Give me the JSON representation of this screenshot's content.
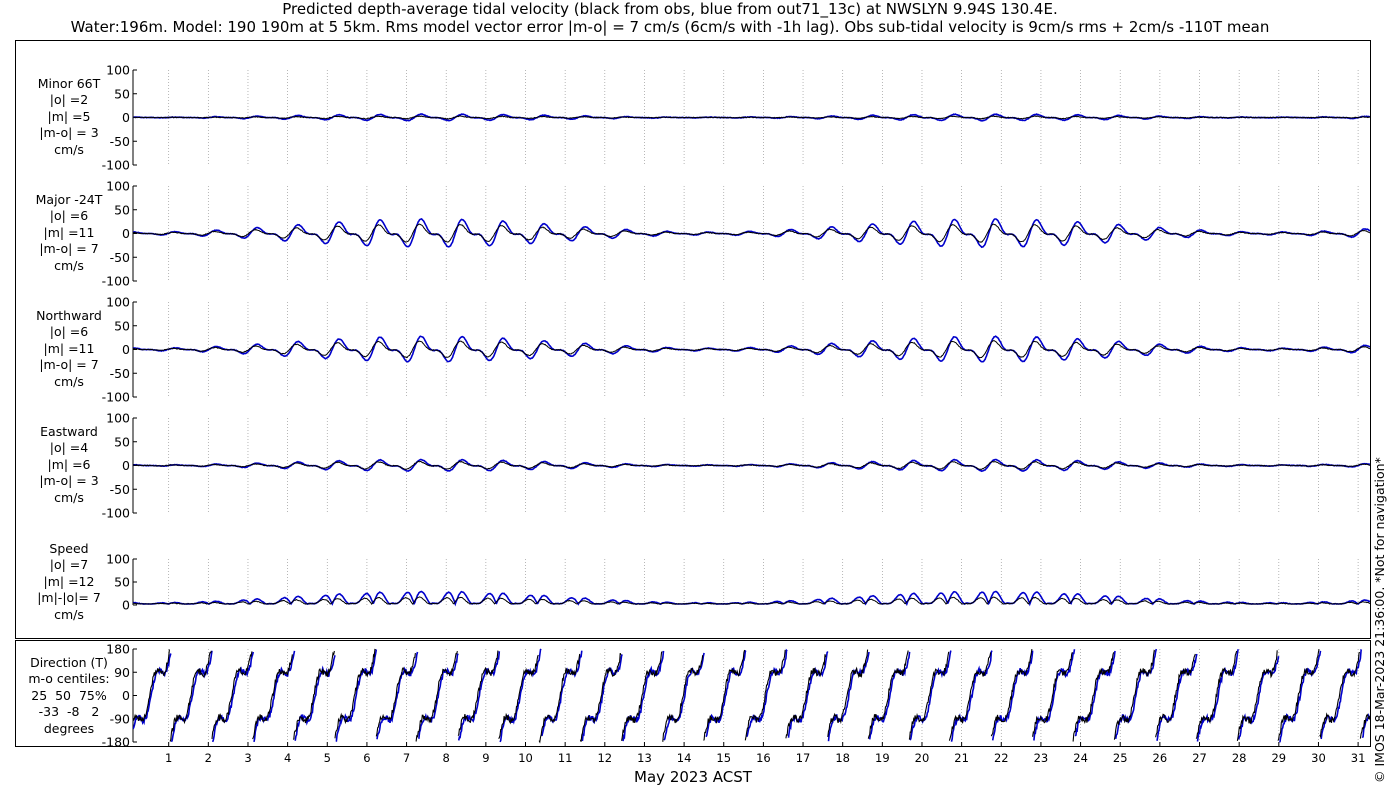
{
  "title_line1": "Predicted depth-average tidal velocity (black from obs, blue from out71_13c) at NWSLYN 9.94S 130.4E.",
  "title_line2": "Water:196m. Model: 190 190m at 5 5km. Rms model vector error |m-o| = 7 cm/s (6cm/s with -1h lag). Obs sub-tidal velocity is 9cm/s rms + 2cm/s -110T mean",
  "copyright": "© IMOS 18-Mar-2023 21:36:00. *Not for navigation*",
  "colors": {
    "obs": "#000000",
    "model": "#0000cc",
    "grid": "#999999"
  },
  "chart_data": {
    "type": "line",
    "xlabel": "May 2023 ACST",
    "xlim": [
      0.1,
      31.3
    ],
    "x_ticks": [
      1,
      2,
      3,
      4,
      5,
      6,
      7,
      8,
      9,
      10,
      11,
      12,
      13,
      14,
      15,
      16,
      17,
      18,
      19,
      20,
      21,
      22,
      23,
      24,
      25,
      26,
      27,
      28,
      29,
      30,
      31
    ],
    "series_legend": {
      "obs": "black from obs",
      "model": "blue from out71_13c"
    },
    "panels": [
      {
        "id": "minor",
        "label": [
          "Minor 66T",
          "|o| =2",
          "|m| =5",
          "|m-o| = 3",
          "cm/s"
        ],
        "ylim": [
          -100,
          100
        ],
        "yticks": [
          100,
          50,
          0,
          -50,
          -100
        ],
        "model_amp": 5,
        "obs_amp": 2,
        "signed": true
      },
      {
        "id": "major",
        "label": [
          "Major -24T",
          "|o| =6",
          "|m| =11",
          "|m-o| = 7",
          "cm/s"
        ],
        "ylim": [
          -100,
          100
        ],
        "yticks": [
          100,
          50,
          0,
          -50,
          -100
        ],
        "model_amp": 22,
        "obs_amp": 14,
        "signed": true
      },
      {
        "id": "north",
        "label": [
          "Northward",
          "|o| =6",
          "|m| =11",
          "|m-o| = 7",
          "cm/s"
        ],
        "ylim": [
          -100,
          100
        ],
        "yticks": [
          100,
          50,
          0,
          -50,
          -100
        ],
        "model_amp": 20,
        "obs_amp": 13,
        "signed": true
      },
      {
        "id": "east",
        "label": [
          "Eastward",
          "|o| =4",
          "|m| =6",
          "|m-o| = 3",
          "cm/s"
        ],
        "ylim": [
          -100,
          100
        ],
        "yticks": [
          100,
          50,
          0,
          -50,
          -100
        ],
        "model_amp": 9,
        "obs_amp": 6,
        "signed": true
      },
      {
        "id": "speed",
        "label": [
          "Speed",
          "|o| =7",
          "|m| =12",
          "|m|-|o|= 7",
          "cm/s"
        ],
        "ylim": [
          0,
          100
        ],
        "yticks": [
          100,
          50,
          0
        ],
        "model_amp": 22,
        "obs_amp": 12,
        "signed": false
      },
      {
        "id": "direction",
        "label": [
          "Direction (T)",
          "m-o centiles:",
          "25  50  75%",
          "-33  -8   2",
          "degrees"
        ],
        "ylim": [
          -180,
          180
        ],
        "yticks": [
          180,
          90,
          0,
          -90,
          -180
        ],
        "type": "direction"
      }
    ]
  }
}
